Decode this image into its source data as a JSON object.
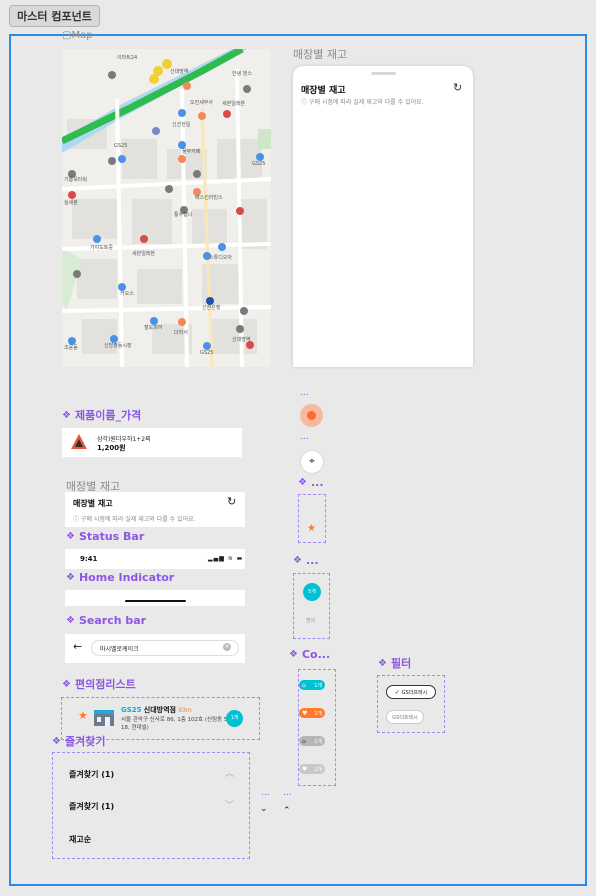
{
  "tab": {
    "label": "마스터 컴포넌트"
  },
  "map_label": "Map",
  "map_places": [
    "이마트24",
    "시대행",
    "신대방역",
    "안녕 덴스",
    "조판녹",
    "오진세무사",
    "세븐일레븐",
    "신선한일",
    "GS25",
    "GS25",
    "맨찌다",
    "기룡옥타워",
    "이대나",
    "물무카페",
    "세븐일레븐",
    "GS25",
    "실세분",
    "베스킨라빈스",
    "통수합니",
    "가야도토중",
    "세븐일레븐",
    "스튜디오아",
    "CU",
    "카오스",
    "조윤신도 누이하트",
    "철도피어",
    "더마서",
    "신한은행",
    "경찰흔",
    "신대방역 세스트럼",
    "신방출동시장",
    "GS25",
    "CU",
    "조윤동 행정센터"
  ],
  "stock_top": {
    "label": "매장별 재고",
    "title": "매장별 재고",
    "note": "구매 시점에 따라 실제 재고와 다를 수 있어요."
  },
  "product": {
    "title": "제품이름_가격",
    "name": "삼각)원더우하1+2찌",
    "price": "1,200원"
  },
  "stock_small": {
    "label": "매장별 재고",
    "title": "매장별 재고",
    "note": "구매 시점에 따라 실제 재고와 다를 수 있어요."
  },
  "status_bar": {
    "title": "Status Bar",
    "time": "9:41"
  },
  "home_indicator": {
    "title": "Home Indicator"
  },
  "search_bar": {
    "title": "Search bar",
    "query": "마시멜로케이크"
  },
  "store_list": {
    "title": "편의점리스트",
    "brand": "GS25",
    "store": "신대방역점",
    "distance": "93m",
    "address": "서울 관악구 신사로 86, 1층 102호 (신림동 518-18, 현대빌)",
    "count": "1개"
  },
  "favorites": {
    "title": "즐겨찾기",
    "item1": "즐겨찾기 (1)",
    "item2": "즐겨찾기 (1)",
    "item3": "재고순"
  },
  "dots": {
    "a": "...",
    "b": "...",
    "c": "...",
    "d": "...",
    "e": "...",
    "f": "..."
  },
  "small_comp": {
    "t1": "...",
    "t2": "...",
    "t3": "Co...",
    "chip_count": "1개",
    "sub_count": "5개",
    "sub_label": "편의"
  },
  "filter": {
    "title": "필터",
    "opt1": "GS더프레시",
    "opt2": "GS더프레시"
  },
  "colors": {
    "accent": "#8d57e6",
    "frame": "#2b8ce6",
    "brand": "#00c1d4",
    "orange": "#ff7a2b"
  }
}
